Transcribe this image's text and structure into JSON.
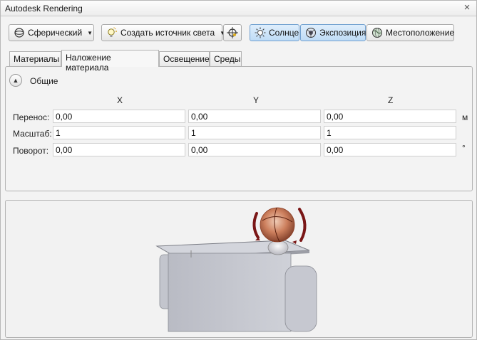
{
  "window": {
    "title": "Autodesk Rendering"
  },
  "toolbar": {
    "spherical_label": "Сферический",
    "create_light_label": "Создать источник света",
    "sun_label": "Солнце",
    "exposure_label": "Экспозиция",
    "location_label": "Местоположение"
  },
  "tabs": [
    {
      "label": "Материалы"
    },
    {
      "label": "Наложение материала"
    },
    {
      "label": "Освещение"
    },
    {
      "label": "Среды"
    }
  ],
  "general": {
    "title": "Общие",
    "axes": [
      "X",
      "Y",
      "Z"
    ],
    "rows": [
      {
        "label": "Перенос:",
        "x": "0,00",
        "y": "0,00",
        "z": "0,00",
        "unit": "м"
      },
      {
        "label": "Масштаб:",
        "x": "1",
        "y": "1",
        "z": "1",
        "unit": ""
      },
      {
        "label": "Поворот:",
        "x": "0,00",
        "y": "0,00",
        "z": "0,00",
        "unit": "°"
      }
    ]
  },
  "colors": {
    "active_button": "#bfdcf6",
    "sphere": "#b5603c",
    "arrows": "#7a1616",
    "box": "#c7c9d1"
  }
}
